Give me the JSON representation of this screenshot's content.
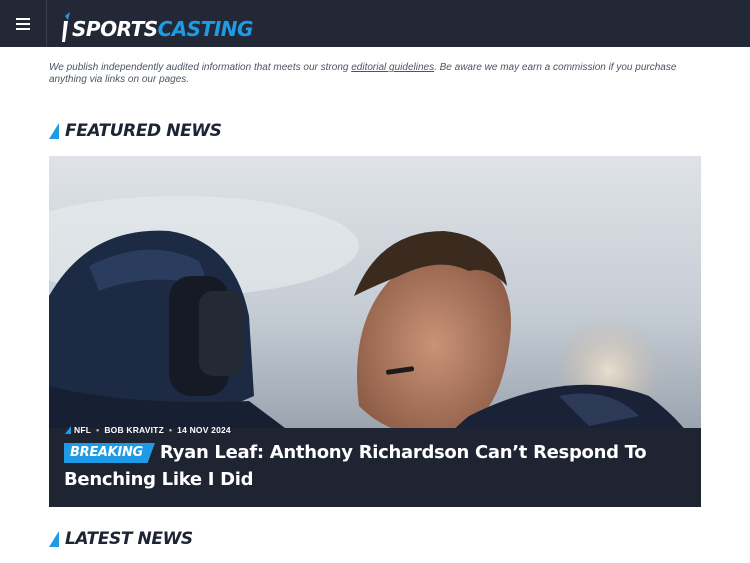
{
  "header": {
    "logo_sports": "SPORTS",
    "logo_casting": "CASTING",
    "menu_icon": "hamburger-icon"
  },
  "disclaimer": {
    "before": "We publish independently audited information that meets our strong ",
    "link": "editorial guidelines",
    "after": ". Be aware we may earn a commission if you purchase anything via links on our pages."
  },
  "featured": {
    "title": "FEATURED NEWS",
    "article": {
      "category": "NFL",
      "author": "BOB KRAVITZ",
      "date": "14 NOV 2024",
      "badge": "BREAKING",
      "headline": "Ryan Leaf: Anthony Richardson Can’t Respond To Benching Like I Did"
    }
  },
  "latest": {
    "title": "LATEST NEWS"
  },
  "colors": {
    "topbar": "#232836",
    "accent": "#1f9be6",
    "heading": "#1d2434",
    "card_bg": "#1f2433"
  }
}
